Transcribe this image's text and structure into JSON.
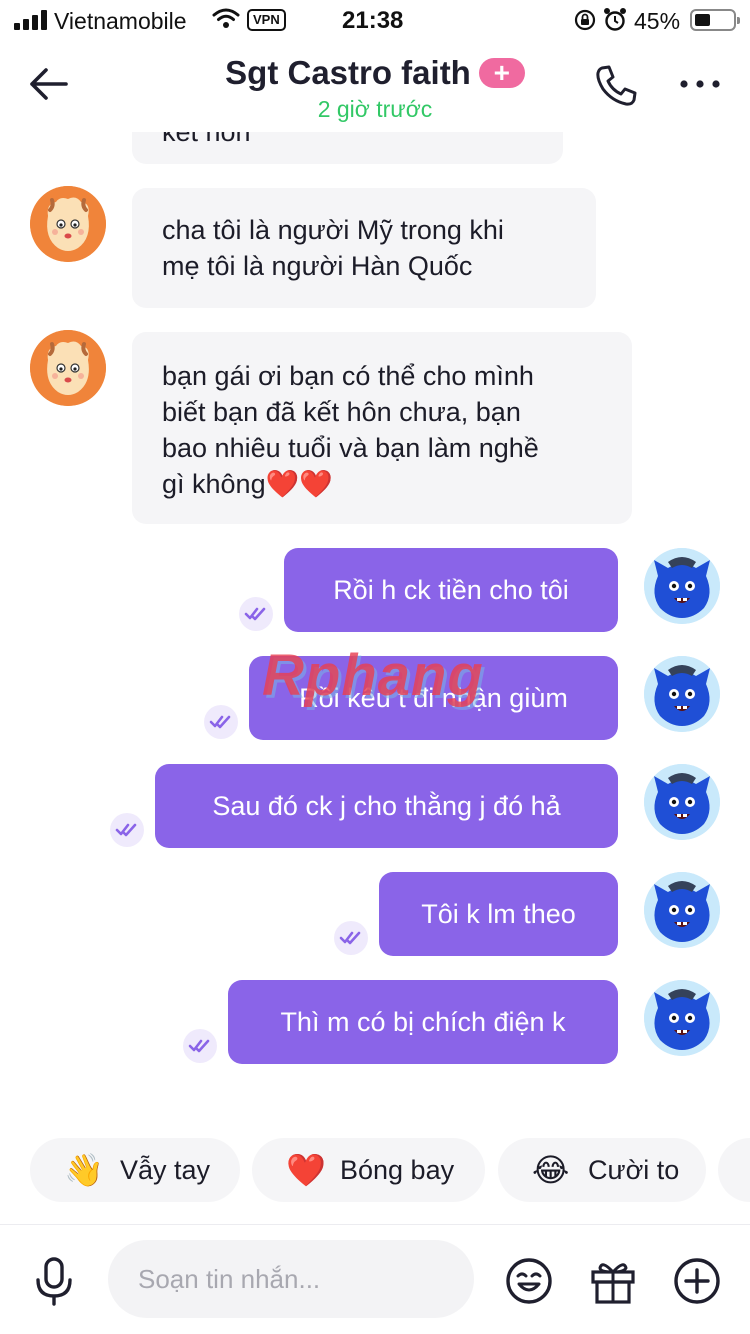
{
  "status_bar": {
    "carrier": "Vietnamobile",
    "vpn": "VPN",
    "time": "21:38",
    "battery": "45%"
  },
  "header": {
    "name": "Sgt Castro faith",
    "badge": "+",
    "last_seen": "2 giờ trước"
  },
  "messages": {
    "partial": "kết hôn",
    "in": [
      {
        "lines": [
          "cha tôi là người Mỹ trong khi",
          "mẹ tôi là người Hàn Quốc"
        ]
      },
      {
        "lines": [
          "bạn gái ơi bạn có thể cho mình",
          "biết bạn đã kết hôn chưa, bạn",
          "bao nhiêu tuổi và bạn làm nghề",
          "gì không❤️❤️"
        ]
      }
    ],
    "out": [
      {
        "text": "Rồi h ck tiền cho tôi"
      },
      {
        "text": "Rồi kêu t đi nhận giùm"
      },
      {
        "text": "Sau đó ck j cho thằng j đó hả"
      },
      {
        "text": "Tôi k lm theo"
      },
      {
        "text": "Thì m có bị chích điện k"
      }
    ]
  },
  "watermark": "Rphang",
  "quick_replies": [
    {
      "label": "Vẫy tay",
      "emoji": "👋"
    },
    {
      "label": "Bóng bay",
      "emoji": "❤️"
    },
    {
      "label": "Cười to",
      "emoji": "😂"
    }
  ],
  "composer": {
    "placeholder": "Soạn tin nhắn..."
  },
  "icons": {
    "accent": "#8a64e8",
    "online": "#32c866",
    "badge": "#f06aa0"
  }
}
